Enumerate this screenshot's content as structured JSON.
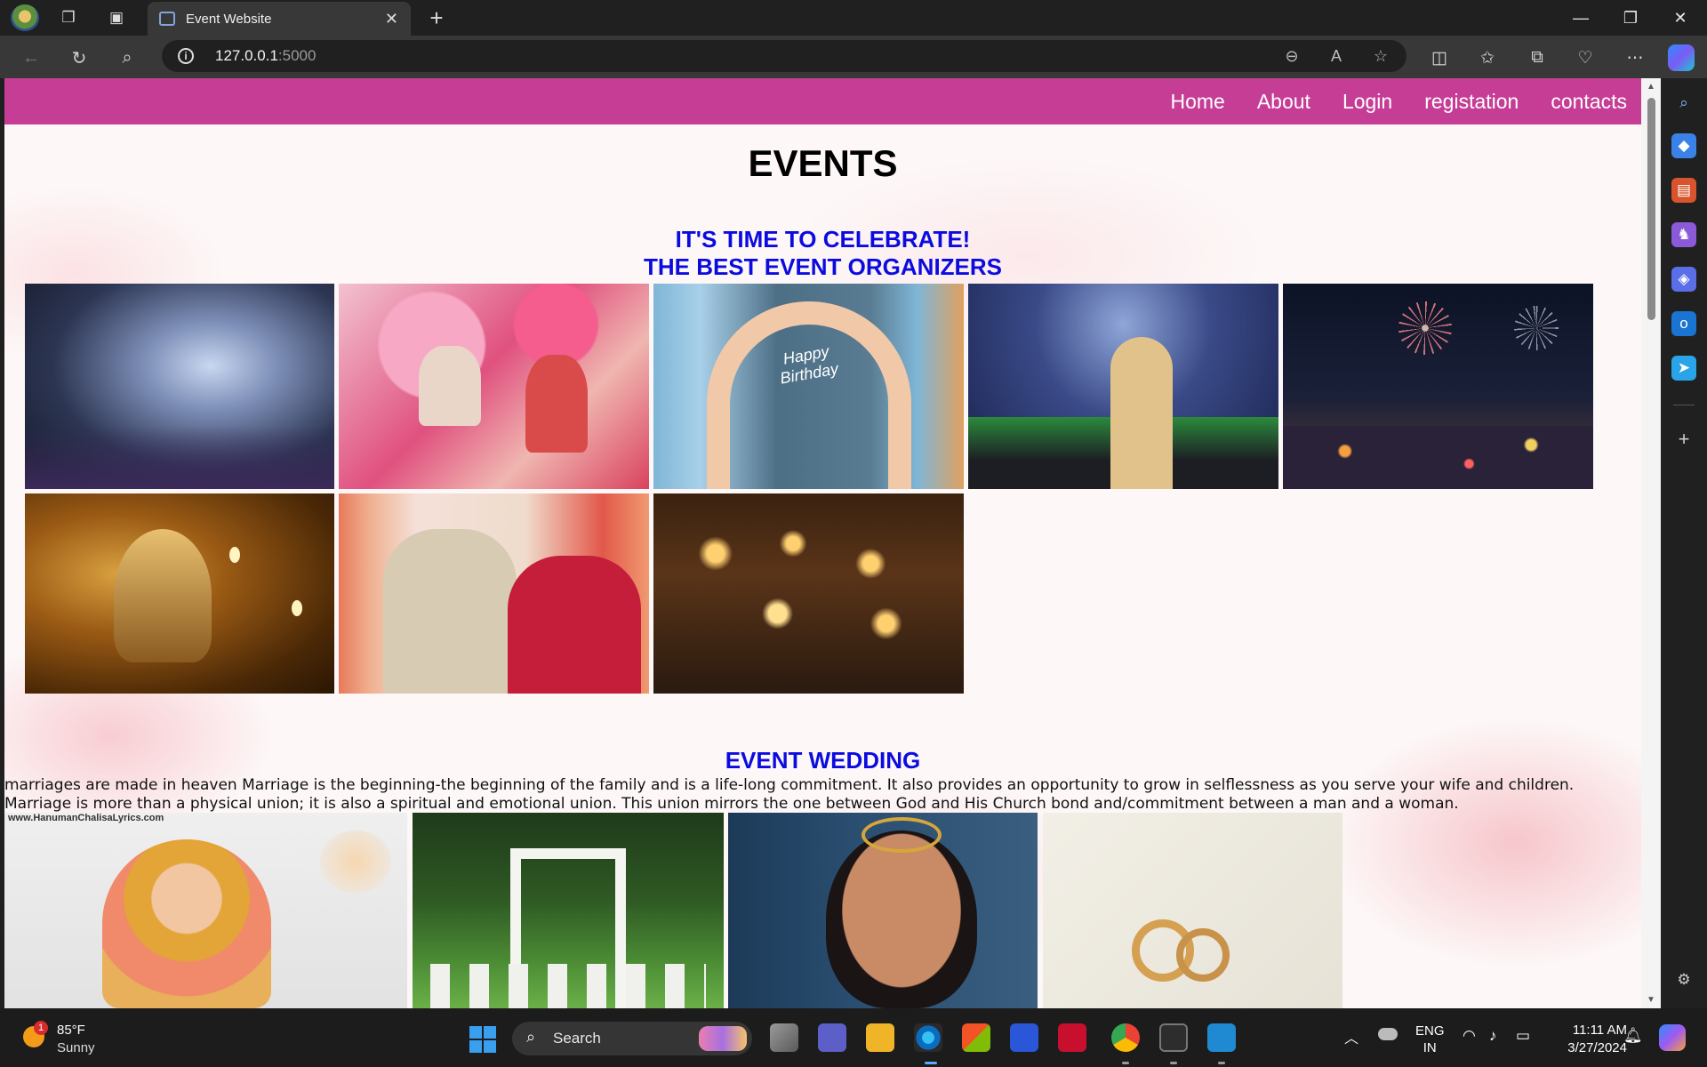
{
  "browser": {
    "tab_title": "Event Website",
    "url_host": "127.0.0.1",
    "url_port": ":5000",
    "icons": {
      "window_controls": [
        "minimize-icon",
        "restore-icon",
        "close-icon"
      ],
      "nav": [
        "back-icon",
        "refresh-icon",
        "search-icon"
      ],
      "address_bar": [
        "zoom-out-icon",
        "read-aloud-icon",
        "favorite-star-icon"
      ],
      "toolbar": [
        "split-screen-icon",
        "favorites-icon",
        "collections-icon",
        "browser-essentials-icon",
        "more-icon",
        "copilot-icon"
      ]
    }
  },
  "sidebar": {
    "icons": [
      "search-icon",
      "shopping-icon",
      "tools-icon",
      "games-icon",
      "microsoft-365-icon",
      "outlook-icon",
      "drop-icon",
      "add-icon",
      "settings-icon"
    ]
  },
  "site": {
    "nav": [
      "Home",
      "About",
      "Login",
      "registation",
      "contacts"
    ],
    "title": "EVENTS",
    "tagline_1": "IT'S TIME TO CELEBRATE!",
    "tagline_2": "THE BEST EVENT ORGANIZERS",
    "gallery": [
      "confetti-concert-photo",
      "wedding-flower-shower-photo",
      "birthday-balloon-arch-photo",
      "stadium-celebration-photo",
      "city-fireworks-photo",
      "ganesha-diya-photo",
      "surprise-gift-couple-photo",
      "diwali-diyas-photo"
    ],
    "wedding_title": "EVENT WEDDING",
    "wedding_text": "marriages are made in heaven Marriage is the beginning-the beginning of the family and is a life-long commitment. It also provides an opportunity to grow in selflessness as you serve your wife and children. Marriage is more than a physical union; it is also a spiritual and emotional union. This union mirrors the one between God and His Church bond and/commitment between a man and a woman.",
    "wedding_gallery": [
      "hanuman-artwork-photo",
      "garden-wedding-arch-photo",
      "bridal-makeup-photo",
      "wedding-rings-calendar-photo"
    ],
    "watermark": "www.HanumanChalisaLyrics.com",
    "birthday_neon": "Happy Birthday"
  },
  "taskbar": {
    "weather_temp": "85°F",
    "weather_condition": "Sunny",
    "weather_badge": "1",
    "search_label": "Search",
    "apps": [
      "windows-start-icon",
      "task-view-icon",
      "teams-icon",
      "file-explorer-icon",
      "edge-icon",
      "store-icon",
      "power-automate-icon",
      "mcafee-icon",
      "chrome-icon",
      "terminal-icon",
      "vscode-icon"
    ],
    "lang_1": "ENG",
    "lang_2": "IN",
    "time": "11:11 AM",
    "date": "3/27/2024"
  },
  "colors": {
    "navbar": "#c63d96",
    "heading_blue": "#0b0be0",
    "chrome_dark": "#202020"
  }
}
